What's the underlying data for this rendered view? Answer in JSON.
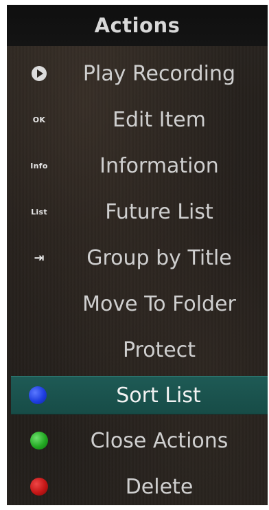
{
  "header": {
    "title": "Actions"
  },
  "items": [
    {
      "label": "Play Recording",
      "icon": "play-icon",
      "icon_text": ""
    },
    {
      "label": "Edit Item",
      "icon": "ok-key-icon",
      "icon_text": "OK"
    },
    {
      "label": "Information",
      "icon": "info-key-icon",
      "icon_text": "Info"
    },
    {
      "label": "Future List",
      "icon": "list-key-icon",
      "icon_text": "List"
    },
    {
      "label": "Group by Title",
      "icon": "tab-arrow-icon",
      "icon_text": "⇥"
    },
    {
      "label": "Move To Folder",
      "icon": "",
      "icon_text": ""
    },
    {
      "label": "Protect",
      "icon": "",
      "icon_text": ""
    },
    {
      "label": "Sort List",
      "icon": "blue-button-icon",
      "icon_text": "",
      "selected": true
    },
    {
      "label": "Close Actions",
      "icon": "green-button-icon",
      "icon_text": ""
    },
    {
      "label": "Delete",
      "icon": "red-button-icon",
      "icon_text": ""
    }
  ],
  "colors": {
    "selected_background": "#1e5a55",
    "blue_button": "#1e3ee0",
    "green_button": "#22a822",
    "red_button": "#c41616"
  }
}
